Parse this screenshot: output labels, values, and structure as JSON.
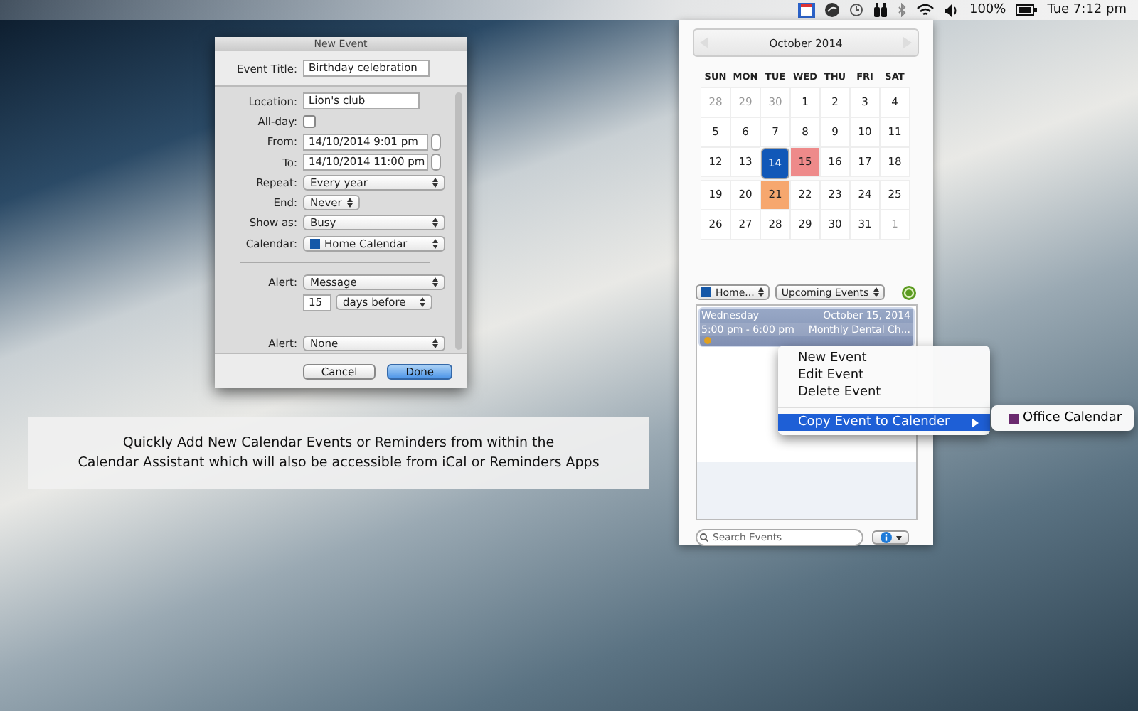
{
  "menu_bar": {
    "battery": "100%",
    "clock": "Tue 7:12 pm"
  },
  "new_event_dialog": {
    "title": "New Event",
    "event_title_label": "Event Title:",
    "event_title": "Birthday celebration",
    "fields": [
      {
        "kind": "text",
        "label": "Location:",
        "value": "Lion's club"
      },
      {
        "kind": "checkbox",
        "label": "All-day:",
        "checked": false
      },
      {
        "kind": "datetime",
        "label": "From:",
        "value": "14/10/2014   9:01 pm"
      },
      {
        "kind": "datetime",
        "label": "To:",
        "value": "14/10/2014 11:00 pm"
      },
      {
        "kind": "select",
        "label": "Repeat:",
        "value": "Every year"
      },
      {
        "kind": "short_select",
        "label": "End:",
        "value": "Never"
      },
      {
        "kind": "select",
        "label": "Show as:",
        "value": "Busy"
      },
      {
        "kind": "calendar",
        "label": "Calendar:",
        "value": "Home Calendar",
        "color": "#1558a8"
      },
      {
        "kind": "divider"
      },
      {
        "kind": "select",
        "label": "Alert:",
        "value": "Message"
      },
      {
        "kind": "number_select",
        "number": "15",
        "value": "days before"
      },
      {
        "kind": "gap"
      },
      {
        "kind": "select",
        "label": "Alert:",
        "value": "None"
      }
    ],
    "buttons": [
      {
        "label": "Cancel",
        "default": false
      },
      {
        "label": "Done",
        "default": true
      }
    ]
  },
  "caption": [
    "Quickly Add New Calendar Events or Reminders from within the",
    "Calendar Assistant which will also be accessible from iCal or Reminders Apps"
  ],
  "calendar_panel": {
    "month": "October 2014",
    "weekdays": [
      "SUN",
      "MON",
      "TUE",
      "WED",
      "THU",
      "FRI",
      "SAT"
    ],
    "weeks": [
      [
        {
          "day": "28",
          "muted": true,
          "selected": false
        },
        {
          "day": "29",
          "muted": true,
          "selected": false
        },
        {
          "day": "30",
          "muted": true,
          "selected": false
        },
        {
          "day": "1",
          "muted": false,
          "selected": false
        },
        {
          "day": "2",
          "muted": false,
          "selected": false
        },
        {
          "day": "3",
          "muted": false,
          "selected": false
        },
        {
          "day": "4",
          "muted": false,
          "selected": false
        }
      ],
      [
        {
          "day": "5",
          "muted": false,
          "selected": false
        },
        {
          "day": "6",
          "muted": false,
          "selected": false
        },
        {
          "day": "7",
          "muted": false,
          "selected": false
        },
        {
          "day": "8",
          "muted": false,
          "selected": false
        },
        {
          "day": "9",
          "muted": false,
          "selected": false
        },
        {
          "day": "10",
          "muted": false,
          "selected": false
        },
        {
          "day": "11",
          "muted": false,
          "selected": false
        }
      ],
      [
        {
          "day": "12",
          "muted": false,
          "selected": false
        },
        {
          "day": "13",
          "muted": false,
          "selected": false
        },
        {
          "day": "14",
          "muted": false,
          "selected": true
        },
        {
          "day": "15",
          "muted": false,
          "selected": false,
          "color": "#ee8a8a"
        },
        {
          "day": "16",
          "muted": false,
          "selected": false
        },
        {
          "day": "17",
          "muted": false,
          "selected": false
        },
        {
          "day": "18",
          "muted": false,
          "selected": false
        }
      ],
      [
        {
          "day": "19",
          "muted": false,
          "selected": false
        },
        {
          "day": "20",
          "muted": false,
          "selected": false
        },
        {
          "day": "21",
          "muted": false,
          "selected": false,
          "color": "#f6a76e"
        },
        {
          "day": "22",
          "muted": false,
          "selected": false
        },
        {
          "day": "23",
          "muted": false,
          "selected": false
        },
        {
          "day": "24",
          "muted": false,
          "selected": false
        },
        {
          "day": "25",
          "muted": false,
          "selected": false
        }
      ],
      [
        {
          "day": "26",
          "muted": false,
          "selected": false
        },
        {
          "day": "27",
          "muted": false,
          "selected": false
        },
        {
          "day": "28",
          "muted": false,
          "selected": false
        },
        {
          "day": "29",
          "muted": false,
          "selected": false
        },
        {
          "day": "30",
          "muted": false,
          "selected": false
        },
        {
          "day": "31",
          "muted": false,
          "selected": false
        },
        {
          "day": "1",
          "muted": true,
          "selected": false
        }
      ]
    ],
    "calendar_filter": {
      "value": "Home...",
      "color": "#1558a8"
    },
    "view_filter": "Upcoming Events",
    "event_groups": [
      {
        "weekday": "Wednesday",
        "date": "October 15, 2014",
        "events": [
          {
            "time": "5:00 pm - 6:00 pm",
            "title": "Monthly Dental Ch..."
          }
        ]
      }
    ],
    "search": {
      "placeholder": "Search Events"
    }
  },
  "context_menu": {
    "items": [
      {
        "kind": "item",
        "label": "New Event",
        "selected": false
      },
      {
        "kind": "item",
        "label": "Edit Event",
        "selected": false
      },
      {
        "kind": "item",
        "label": "Delete Event",
        "selected": false
      },
      {
        "kind": "separator"
      },
      {
        "kind": "submenu",
        "label": "Copy Event to Calender",
        "selected": true
      }
    ],
    "submenu": [
      {
        "label": "Office Calendar",
        "color": "#6a2a6e"
      }
    ]
  }
}
